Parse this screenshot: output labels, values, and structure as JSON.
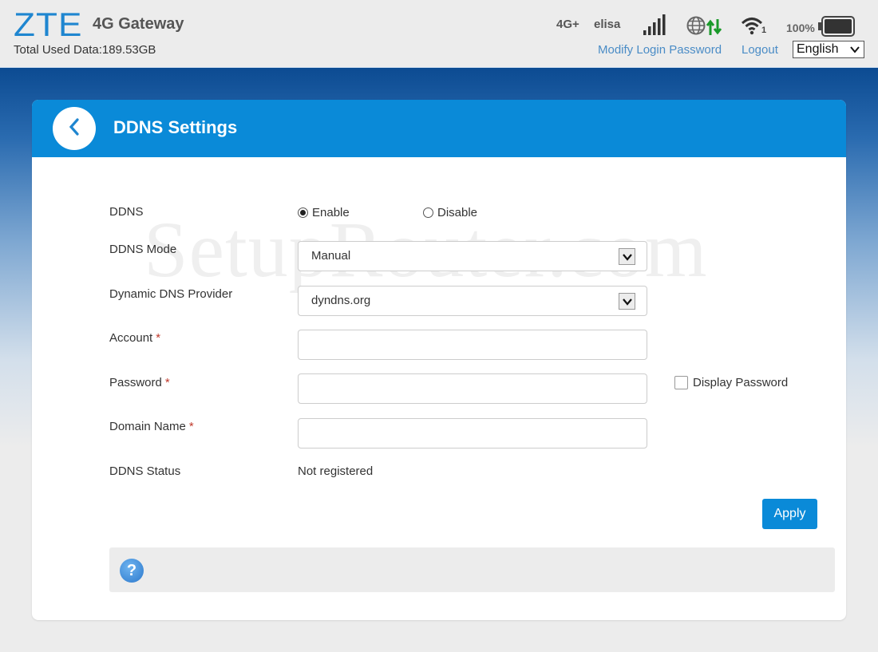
{
  "header": {
    "logo": "ZTE",
    "product": "4G Gateway",
    "used_data_label": "Total Used Data:",
    "used_data_value": "189.53GB",
    "network_type": "4G+",
    "carrier": "elisa",
    "signal_icon": "signal-bars-icon",
    "connection_icon": "globe-data-icon",
    "wifi_icon": "wifi-icon",
    "wifi_clients": "1",
    "battery_percent": "100%",
    "battery_icon": "battery-icon",
    "links": {
      "modify_password": "Modify Login Password",
      "logout": "Logout"
    },
    "language": "English"
  },
  "page": {
    "title": "DDNS Settings",
    "back_icon": "chevron-left-icon",
    "watermark": "SetupRouter.com"
  },
  "form": {
    "ddns": {
      "label": "DDNS",
      "options": [
        "Enable",
        "Disable"
      ],
      "selected": "Enable"
    },
    "mode": {
      "label": "DDNS Mode",
      "value": "Manual"
    },
    "provider": {
      "label": "Dynamic DNS Provider",
      "value": "dyndns.org"
    },
    "account": {
      "label": "Account",
      "required": "*",
      "value": ""
    },
    "password": {
      "label": "Password",
      "required": "*",
      "value": "",
      "display_label": "Display Password",
      "display_checked": false
    },
    "domain": {
      "label": "Domain Name",
      "required": "*",
      "value": ""
    },
    "status": {
      "label": "DDNS Status",
      "value": "Not registered"
    },
    "apply_label": "Apply"
  },
  "help": {
    "icon": "help-icon",
    "glyph": "?"
  },
  "colors": {
    "brand": "#1f86d0",
    "header_bar": "#0a8ad8",
    "link": "#4a8cc6",
    "required": "#c0392b",
    "data_arrows": "#1a9a2a"
  }
}
